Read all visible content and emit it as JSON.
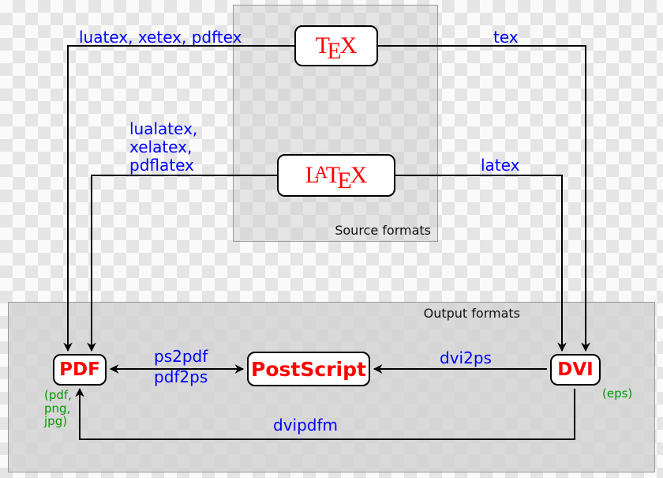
{
  "groups": {
    "source": {
      "label": "Source formats"
    },
    "output": {
      "label": "Output formats"
    }
  },
  "nodes": {
    "tex": "TeX",
    "latex": "LaTeX",
    "pdf": "PDF",
    "postscript": "PostScript",
    "dvi": "DVI"
  },
  "edges": {
    "tex_to_pdf": "luatex, xetex, pdftex",
    "tex_to_dvi": "tex",
    "latex_to_pdf": "lualatex,\nxelatex,\npdflatex",
    "latex_to_dvi": "latex",
    "pdf_to_ps": "pdf2ps",
    "ps_to_pdf": "ps2pdf",
    "dvi_to_ps": "dvi2ps",
    "dvi_to_pdf": "dvipdfm"
  },
  "annotations": {
    "pdf_extra": "(pdf,\npng,\njpg)",
    "dvi_extra": "(eps)"
  }
}
